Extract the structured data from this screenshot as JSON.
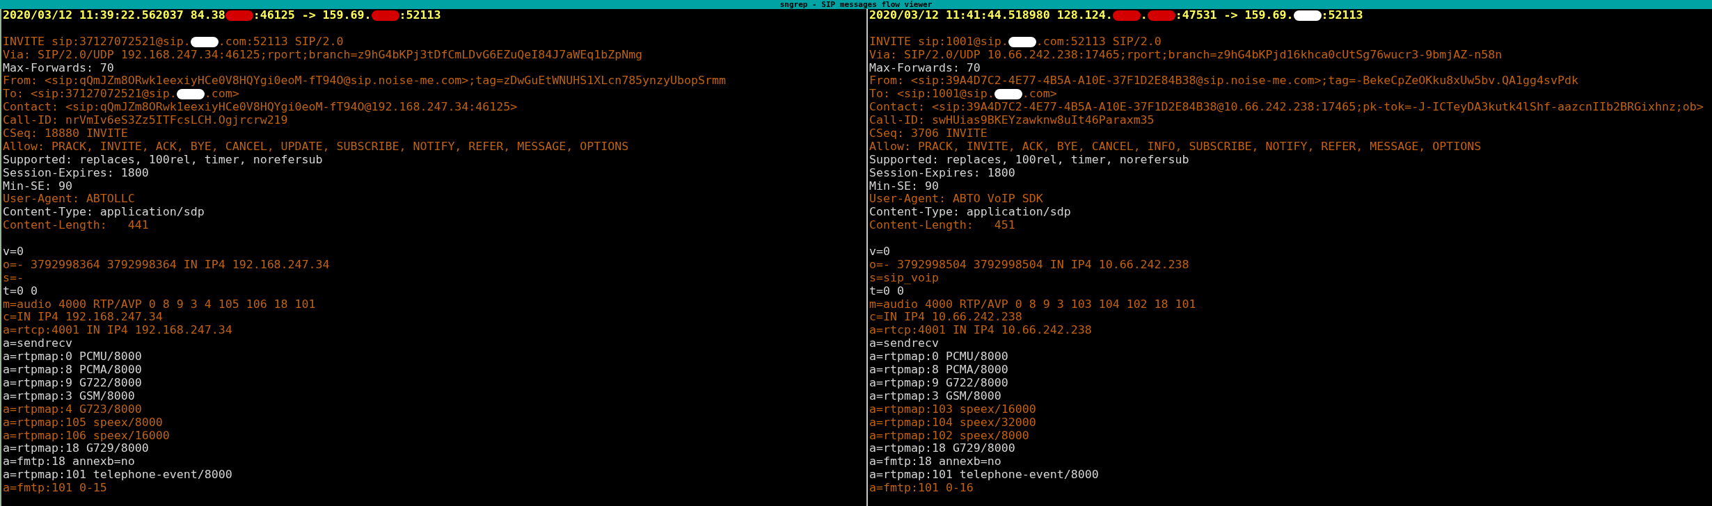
{
  "title_bar": {
    "title": "sngrep - SIP messages flow viewer"
  },
  "panes": [
    {
      "header": {
        "parts": [
          "2020/03/12 11:39:22.562037 84.38",
          ":46125 -> 159.69.",
          ":52113"
        ],
        "masks": [
          {
            "color": "#d40000"
          },
          {
            "color": "#d40000"
          }
        ]
      },
      "sip": [
        {
          "kind": "accent",
          "parts": [
            "INVITE sip:37127072521@sip.",
            ".com:52113 SIP/2.0"
          ],
          "masks": [
            {
              "color": "#ffffff"
            }
          ]
        },
        {
          "kind": "accent",
          "parts": [
            "Via: SIP/2.0/UDP 192.168.247.34:46125;rport;branch=z9hG4bKPj3tDfCmLDvG6EZuQeI84J7aWEq1bZpNmg"
          ]
        },
        {
          "kind": "plain",
          "parts": [
            "Max-Forwards: 70"
          ]
        },
        {
          "kind": "accent",
          "parts": [
            "From: <sip:qQmJZm8ORwk1eexiyHCe0V8HQYgi0eoM-fT94O@sip.noise-me.com>;tag=zDwGuEtWNUHS1XLcn785ynzyUbopSrmm"
          ]
        },
        {
          "kind": "accent",
          "parts": [
            "To: <sip:37127072521@sip.",
            ".com>"
          ],
          "masks": [
            {
              "color": "#ffffff"
            }
          ]
        },
        {
          "kind": "accent",
          "parts": [
            "Contact: <sip:qQmJZm8ORwk1eexiyHCe0V8HQYgi0eoM-fT94O@192.168.247.34:46125>"
          ]
        },
        {
          "kind": "accent",
          "parts": [
            "Call-ID: nrVmIv6eS3Zz5ITFcsLCH.Ogjrcrw219"
          ]
        },
        {
          "kind": "accent",
          "parts": [
            "CSeq: 18880 INVITE"
          ]
        },
        {
          "kind": "accent",
          "parts": [
            "Allow: PRACK, INVITE, ACK, BYE, CANCEL, UPDATE, SUBSCRIBE, NOTIFY, REFER, MESSAGE, OPTIONS"
          ]
        },
        {
          "kind": "plain",
          "parts": [
            "Supported: replaces, 100rel, timer, norefersub"
          ]
        },
        {
          "kind": "plain",
          "parts": [
            "Session-Expires: 1800"
          ]
        },
        {
          "kind": "plain",
          "parts": [
            "Min-SE: 90"
          ]
        },
        {
          "kind": "accent",
          "parts": [
            "User-Agent: ABTOLLC"
          ]
        },
        {
          "kind": "plain",
          "parts": [
            "Content-Type: application/sdp"
          ]
        },
        {
          "kind": "accent",
          "parts": [
            "Content-Length:   441"
          ]
        }
      ],
      "sdp": [
        {
          "kind": "plain",
          "parts": [
            "v=0"
          ]
        },
        {
          "kind": "accent",
          "parts": [
            "o=- 3792998364 3792998364 IN IP4 192.168.247.34"
          ]
        },
        {
          "kind": "accent",
          "parts": [
            "s=-"
          ]
        },
        {
          "kind": "plain",
          "parts": [
            "t=0 0"
          ]
        },
        {
          "kind": "accent",
          "parts": [
            "m=audio 4000 RTP/AVP 0 8 9 3 4 105 106 18 101"
          ]
        },
        {
          "kind": "accent",
          "parts": [
            "c=IN IP4 192.168.247.34"
          ]
        },
        {
          "kind": "accent",
          "parts": [
            "a=rtcp:4001 IN IP4 192.168.247.34"
          ]
        },
        {
          "kind": "plain",
          "parts": [
            "a=sendrecv"
          ]
        },
        {
          "kind": "plain",
          "parts": [
            "a=rtpmap:0 PCMU/8000"
          ]
        },
        {
          "kind": "plain",
          "parts": [
            "a=rtpmap:8 PCMA/8000"
          ]
        },
        {
          "kind": "plain",
          "parts": [
            "a=rtpmap:9 G722/8000"
          ]
        },
        {
          "kind": "plain",
          "parts": [
            "a=rtpmap:3 GSM/8000"
          ]
        },
        {
          "kind": "accent",
          "parts": [
            "a=rtpmap:4 G723/8000"
          ]
        },
        {
          "kind": "accent",
          "parts": [
            "a=rtpmap:105 speex/8000"
          ]
        },
        {
          "kind": "accent",
          "parts": [
            "a=rtpmap:106 speex/16000"
          ]
        },
        {
          "kind": "plain",
          "parts": [
            "a=rtpmap:18 G729/8000"
          ]
        },
        {
          "kind": "plain",
          "parts": [
            "a=fmtp:18 annexb=no"
          ]
        },
        {
          "kind": "plain",
          "parts": [
            "a=rtpmap:101 telephone-event/8000"
          ]
        },
        {
          "kind": "accent",
          "parts": [
            "a=fmtp:101 0-15"
          ]
        }
      ]
    },
    {
      "header": {
        "parts": [
          "2020/03/12 11:41:44.518980 128.124.",
          ".",
          ":47531 -> 159.69.",
          ":52113"
        ],
        "masks": [
          {
            "color": "#d40000"
          },
          {
            "color": "#d40000"
          },
          {
            "color": "#ffffff"
          }
        ]
      },
      "sip": [
        {
          "kind": "accent",
          "parts": [
            "INVITE sip:1001@sip.",
            ".com:52113 SIP/2.0"
          ],
          "masks": [
            {
              "color": "#ffffff"
            }
          ]
        },
        {
          "kind": "accent",
          "parts": [
            "Via: SIP/2.0/UDP 10.66.242.238:17465;rport;branch=z9hG4bKPjd16khca0cUtSg76wucr3-9bmjAZ-n58n"
          ]
        },
        {
          "kind": "plain",
          "parts": [
            "Max-Forwards: 70"
          ]
        },
        {
          "kind": "accent",
          "parts": [
            "From: <sip:39A4D7C2-4E77-4B5A-A10E-37F1D2E84B38@sip.noise-me.com>;tag=-BekeCpZeOKku8xUw5bv.QA1gg4svPdk"
          ]
        },
        {
          "kind": "accent",
          "parts": [
            "To: <sip:1001@sip.",
            ".com>"
          ],
          "masks": [
            {
              "color": "#ffffff"
            }
          ]
        },
        {
          "kind": "accent",
          "parts": [
            "Contact: <sip:39A4D7C2-4E77-4B5A-A10E-37F1D2E84B38@10.66.242.238:17465;pk-tok=-J-ICTeyDA3kutk4lShf-aazcnIIb2BRGixhnz;ob>"
          ]
        },
        {
          "kind": "accent",
          "parts": [
            "Call-ID: swHUias9BKEYzawknw8uIt46Paraxm35"
          ]
        },
        {
          "kind": "accent",
          "parts": [
            "CSeq: 3706 INVITE"
          ]
        },
        {
          "kind": "accent",
          "parts": [
            "Allow: PRACK, INVITE, ACK, BYE, CANCEL, INFO, SUBSCRIBE, NOTIFY, REFER, MESSAGE, OPTIONS"
          ]
        },
        {
          "kind": "plain",
          "parts": [
            "Supported: replaces, 100rel, timer, norefersub"
          ]
        },
        {
          "kind": "plain",
          "parts": [
            "Session-Expires: 1800"
          ]
        },
        {
          "kind": "plain",
          "parts": [
            "Min-SE: 90"
          ]
        },
        {
          "kind": "accent",
          "parts": [
            "User-Agent: ABTO VoIP SDK"
          ]
        },
        {
          "kind": "plain",
          "parts": [
            "Content-Type: application/sdp"
          ]
        },
        {
          "kind": "accent",
          "parts": [
            "Content-Length:   451"
          ]
        }
      ],
      "sdp": [
        {
          "kind": "plain",
          "parts": [
            "v=0"
          ]
        },
        {
          "kind": "accent",
          "parts": [
            "o=- 3792998504 3792998504 IN IP4 10.66.242.238"
          ]
        },
        {
          "kind": "accent",
          "parts": [
            "s=sip_voip"
          ]
        },
        {
          "kind": "plain",
          "parts": [
            "t=0 0"
          ]
        },
        {
          "kind": "accent",
          "parts": [
            "m=audio 4000 RTP/AVP 0 8 9 3 103 104 102 18 101"
          ]
        },
        {
          "kind": "accent",
          "parts": [
            "c=IN IP4 10.66.242.238"
          ]
        },
        {
          "kind": "accent",
          "parts": [
            "a=rtcp:4001 IN IP4 10.66.242.238"
          ]
        },
        {
          "kind": "plain",
          "parts": [
            "a=sendrecv"
          ]
        },
        {
          "kind": "plain",
          "parts": [
            "a=rtpmap:0 PCMU/8000"
          ]
        },
        {
          "kind": "plain",
          "parts": [
            "a=rtpmap:8 PCMA/8000"
          ]
        },
        {
          "kind": "plain",
          "parts": [
            "a=rtpmap:9 G722/8000"
          ]
        },
        {
          "kind": "plain",
          "parts": [
            "a=rtpmap:3 GSM/8000"
          ]
        },
        {
          "kind": "accent",
          "parts": [
            "a=rtpmap:103 speex/16000"
          ]
        },
        {
          "kind": "accent",
          "parts": [
            "a=rtpmap:104 speex/32000"
          ]
        },
        {
          "kind": "accent",
          "parts": [
            "a=rtpmap:102 speex/8000"
          ]
        },
        {
          "kind": "plain",
          "parts": [
            "a=rtpmap:18 G729/8000"
          ]
        },
        {
          "kind": "plain",
          "parts": [
            "a=fmtp:18 annexb=no"
          ]
        },
        {
          "kind": "plain",
          "parts": [
            "a=rtpmap:101 telephone-event/8000"
          ]
        },
        {
          "kind": "accent",
          "parts": [
            "a=fmtp:101 0-16"
          ]
        }
      ]
    }
  ]
}
